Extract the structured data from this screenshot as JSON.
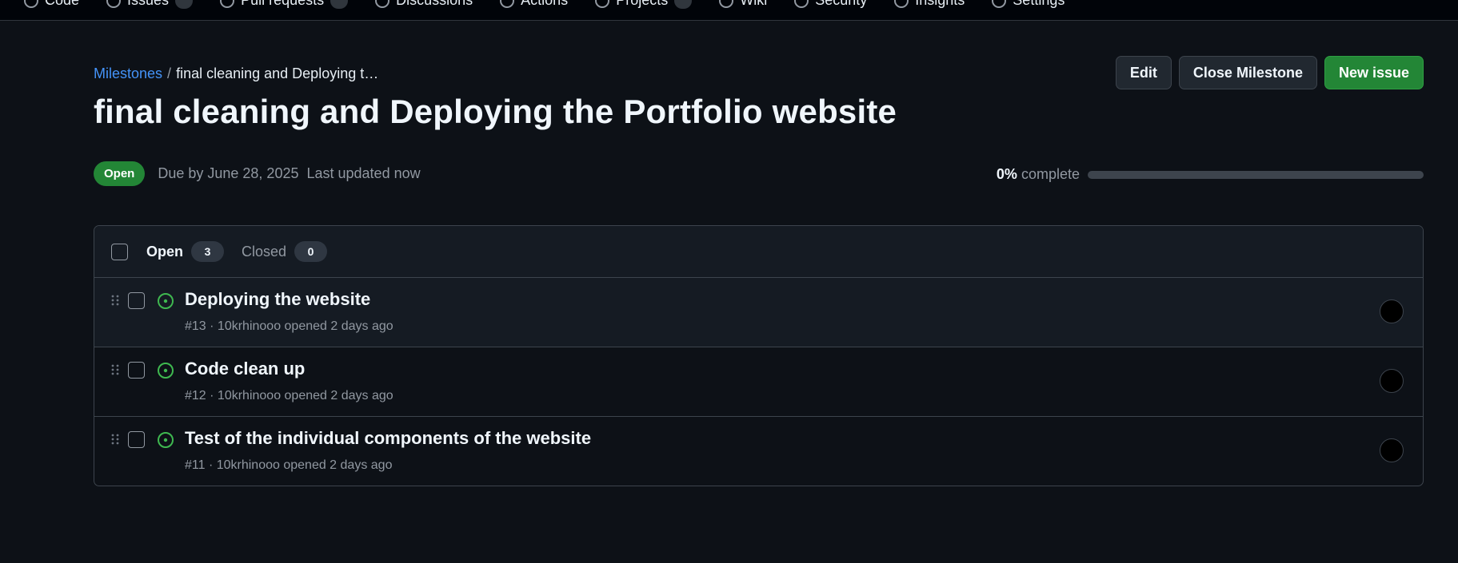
{
  "repo_nav": {
    "tabs": [
      {
        "label": "Code",
        "icon": "code-icon"
      },
      {
        "label": "Issues",
        "icon": "issue-opened-icon"
      },
      {
        "label": "Pull requests",
        "icon": "git-pull-request-icon"
      },
      {
        "label": "Discussions",
        "icon": "comment-discussion-icon"
      },
      {
        "label": "Actions",
        "icon": "play-icon"
      },
      {
        "label": "Projects",
        "icon": "table-icon"
      },
      {
        "label": "Wiki",
        "icon": "book-icon"
      },
      {
        "label": "Security",
        "icon": "shield-icon"
      },
      {
        "label": "Insights",
        "icon": "graph-icon"
      },
      {
        "label": "Settings",
        "icon": "gear-icon"
      }
    ]
  },
  "breadcrumb": {
    "parent": "Milestones",
    "separator": "/",
    "current": "final cleaning and Deploying t…"
  },
  "actions": {
    "edit": "Edit",
    "close_milestone": "Close Milestone",
    "new_issue": "New issue"
  },
  "milestone": {
    "title": "final cleaning and Deploying the Portfolio website",
    "state": "Open",
    "due": "Due by June 28, 2025",
    "updated": "Last updated now",
    "percent_label": "0%",
    "complete_label": "complete",
    "progress_fraction": 0
  },
  "list": {
    "open_label": "Open",
    "open_count": "3",
    "closed_label": "Closed",
    "closed_count": "0",
    "issues": [
      {
        "title": "Deploying the website",
        "meta": "#13 · 10krhinooo opened 2 days ago"
      },
      {
        "title": "Code clean up",
        "meta": "#12 · 10krhinooo opened 2 days ago"
      },
      {
        "title": "Test of the individual components of the website",
        "meta": "#11 · 10krhinooo opened 2 days ago"
      }
    ]
  },
  "colors": {
    "background": "#0d1117",
    "accent_link": "#4493f8",
    "success": "#238636",
    "open_icon": "#3fb950"
  }
}
